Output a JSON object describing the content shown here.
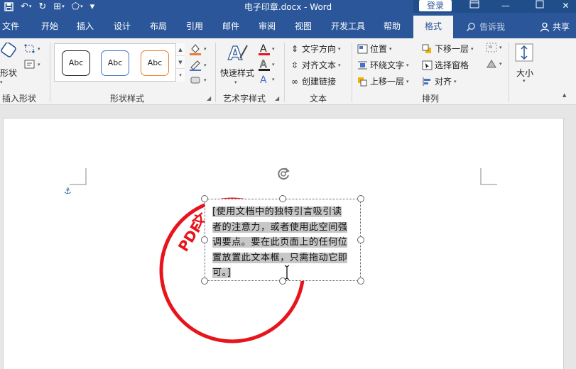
{
  "window": {
    "title": "电子印章.docx - Word",
    "login_label": "登录"
  },
  "tabs": {
    "file": "文件",
    "home": "开始",
    "insert": "插入",
    "design": "设计",
    "layout": "布局",
    "references": "引用",
    "mailings": "邮件",
    "review": "审阅",
    "view": "视图",
    "developer": "开发工具",
    "help": "帮助",
    "format": "格式",
    "tell_me": "告诉我",
    "share": "共享"
  },
  "ribbon": {
    "insert_shapes": {
      "label": "插入形状",
      "shapes_button": "形状"
    },
    "shape_styles": {
      "label": "形状样式",
      "swatches": [
        {
          "text": "Abc",
          "border": "#222222"
        },
        {
          "text": "Abc",
          "border": "#4472c4"
        },
        {
          "text": "Abc",
          "border": "#ed7d31"
        }
      ]
    },
    "wordart": {
      "label": "艺术字样式",
      "quick_styles": "快速样式"
    },
    "text": {
      "label": "文本",
      "text_direction": "文字方向",
      "align_text": "对齐文本",
      "create_link": "创建链接"
    },
    "arrange": {
      "label": "排列",
      "position": "位置",
      "wrap_text": "环绕文字",
      "bring_forward": "上移一层",
      "send_backward": "下移一层",
      "selection_pane": "选择窗格",
      "align": "对齐"
    },
    "size": {
      "label": "大小"
    }
  },
  "document": {
    "textbox_text": "[使用文档中的独特引言吸引读者的注意力，或者使用此空间强调要点。要在此页面上的任何位置放置此文本框，只需拖动它即可。]",
    "textbox_lines": [
      "[使用文档中的独特引言吸引读",
      "者的注意力，或者使用此空间强",
      "调要点。要在此页面上的任何位",
      "置放置此文本框，只需拖动它即",
      "可。]"
    ],
    "stamp_text": "PDF"
  },
  "colors": {
    "title_bar": "#2b579a",
    "stamp_red": "#e8141c"
  }
}
